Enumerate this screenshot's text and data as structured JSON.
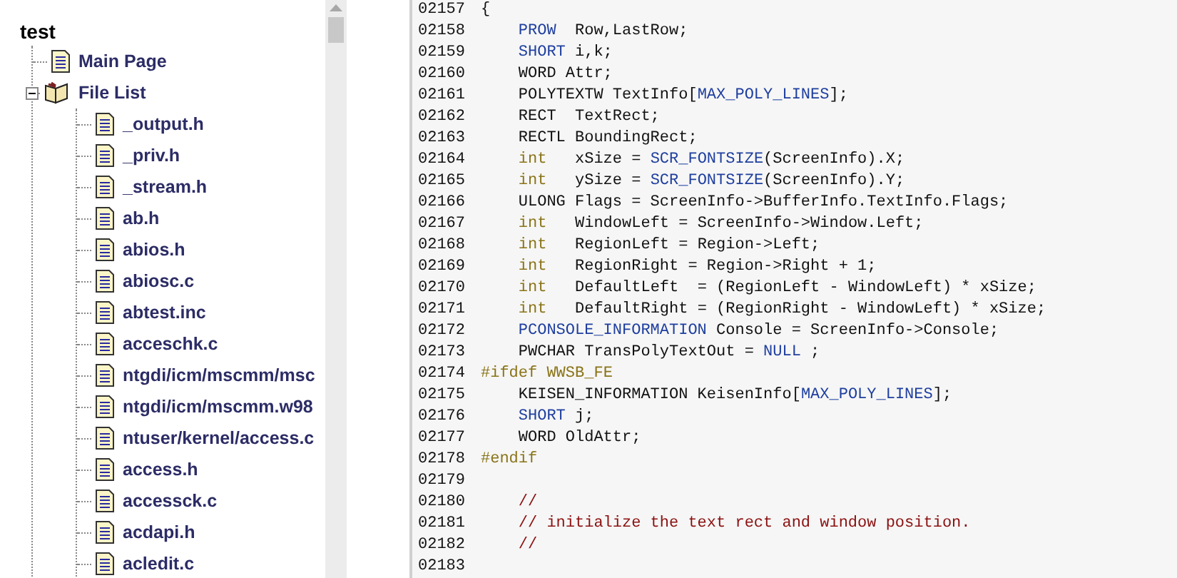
{
  "tree": {
    "root": "test",
    "children": [
      {
        "label": "Main Page",
        "kind": "page"
      },
      {
        "label": "File List",
        "kind": "book",
        "expanded": true,
        "children": [
          {
            "label": "_output.h",
            "kind": "page"
          },
          {
            "label": "_priv.h",
            "kind": "page"
          },
          {
            "label": "_stream.h",
            "kind": "page"
          },
          {
            "label": "ab.h",
            "kind": "page"
          },
          {
            "label": "abios.h",
            "kind": "page"
          },
          {
            "label": "abiosc.c",
            "kind": "page"
          },
          {
            "label": "abtest.inc",
            "kind": "page"
          },
          {
            "label": "acceschk.c",
            "kind": "page"
          },
          {
            "label": "ntgdi/icm/mscmm/msc",
            "kind": "page"
          },
          {
            "label": "ntgdi/icm/mscmm.w98",
            "kind": "page"
          },
          {
            "label": "ntuser/kernel/access.c",
            "kind": "page"
          },
          {
            "label": "access.h",
            "kind": "page"
          },
          {
            "label": "accessck.c",
            "kind": "page"
          },
          {
            "label": "acdapi.h",
            "kind": "page"
          },
          {
            "label": "acledit.c",
            "kind": "page"
          }
        ]
      }
    ]
  },
  "code": {
    "lines": [
      {
        "number": "02157",
        "indent": false,
        "segments": [
          {
            "kind": "plain",
            "text": "{"
          }
        ]
      },
      {
        "number": "02158",
        "indent": true,
        "segments": [
          {
            "kind": "keyword",
            "text": "PROW"
          },
          {
            "kind": "plain",
            "text": "  Row,LastRow;"
          }
        ]
      },
      {
        "number": "02159",
        "indent": true,
        "segments": [
          {
            "kind": "keyword",
            "text": "SHORT"
          },
          {
            "kind": "plain",
            "text": " i,k;"
          }
        ]
      },
      {
        "number": "02160",
        "indent": true,
        "segments": [
          {
            "kind": "plain",
            "text": "WORD Attr;"
          }
        ]
      },
      {
        "number": "02161",
        "indent": true,
        "segments": [
          {
            "kind": "plain",
            "text": "POLYTEXTW TextInfo["
          },
          {
            "kind": "keyword",
            "text": "MAX_POLY_LINES"
          },
          {
            "kind": "plain",
            "text": "];"
          }
        ]
      },
      {
        "number": "02162",
        "indent": true,
        "segments": [
          {
            "kind": "plain",
            "text": "RECT  TextRect;"
          }
        ]
      },
      {
        "number": "02163",
        "indent": true,
        "segments": [
          {
            "kind": "plain",
            "text": "RECTL BoundingRect;"
          }
        ]
      },
      {
        "number": "02164",
        "indent": true,
        "segments": [
          {
            "kind": "type",
            "text": "int"
          },
          {
            "kind": "plain",
            "text": "   xSize = "
          },
          {
            "kind": "keyword",
            "text": "SCR_FONTSIZE"
          },
          {
            "kind": "plain",
            "text": "(ScreenInfo).X;"
          }
        ]
      },
      {
        "number": "02165",
        "indent": true,
        "segments": [
          {
            "kind": "type",
            "text": "int"
          },
          {
            "kind": "plain",
            "text": "   ySize = "
          },
          {
            "kind": "keyword",
            "text": "SCR_FONTSIZE"
          },
          {
            "kind": "plain",
            "text": "(ScreenInfo).Y;"
          }
        ]
      },
      {
        "number": "02166",
        "indent": true,
        "segments": [
          {
            "kind": "plain",
            "text": "ULONG Flags = ScreenInfo->BufferInfo.TextInfo.Flags;"
          }
        ]
      },
      {
        "number": "02167",
        "indent": true,
        "segments": [
          {
            "kind": "type",
            "text": "int"
          },
          {
            "kind": "plain",
            "text": "   WindowLeft = ScreenInfo->Window.Left;"
          }
        ]
      },
      {
        "number": "02168",
        "indent": true,
        "segments": [
          {
            "kind": "type",
            "text": "int"
          },
          {
            "kind": "plain",
            "text": "   RegionLeft = Region->Left;"
          }
        ]
      },
      {
        "number": "02169",
        "indent": true,
        "segments": [
          {
            "kind": "type",
            "text": "int"
          },
          {
            "kind": "plain",
            "text": "   RegionRight = Region->Right + 1;"
          }
        ]
      },
      {
        "number": "02170",
        "indent": true,
        "segments": [
          {
            "kind": "type",
            "text": "int"
          },
          {
            "kind": "plain",
            "text": "   DefaultLeft  = (RegionLeft - WindowLeft) * xSize;"
          }
        ]
      },
      {
        "number": "02171",
        "indent": true,
        "segments": [
          {
            "kind": "type",
            "text": "int"
          },
          {
            "kind": "plain",
            "text": "   DefaultRight = (RegionRight - WindowLeft) * xSize;"
          }
        ]
      },
      {
        "number": "02172",
        "indent": true,
        "segments": [
          {
            "kind": "keyword",
            "text": "PCONSOLE_INFORMATION"
          },
          {
            "kind": "plain",
            "text": " Console = ScreenInfo->Console;"
          }
        ]
      },
      {
        "number": "02173",
        "indent": true,
        "segments": [
          {
            "kind": "plain",
            "text": "PWCHAR TransPolyTextOut = "
          },
          {
            "kind": "keyword",
            "text": "NULL"
          },
          {
            "kind": "plain",
            "text": " ;"
          }
        ]
      },
      {
        "number": "02174",
        "indent": false,
        "segments": [
          {
            "kind": "preproc",
            "text": "#ifdef WWSB_FE"
          }
        ]
      },
      {
        "number": "02175",
        "indent": true,
        "segments": [
          {
            "kind": "plain",
            "text": "KEISEN_INFORMATION KeisenInfo["
          },
          {
            "kind": "keyword",
            "text": "MAX_POLY_LINES"
          },
          {
            "kind": "plain",
            "text": "];"
          }
        ]
      },
      {
        "number": "02176",
        "indent": true,
        "segments": [
          {
            "kind": "keyword",
            "text": "SHORT"
          },
          {
            "kind": "plain",
            "text": " j;"
          }
        ]
      },
      {
        "number": "02177",
        "indent": true,
        "segments": [
          {
            "kind": "plain",
            "text": "WORD OldAttr;"
          }
        ]
      },
      {
        "number": "02178",
        "indent": false,
        "segments": [
          {
            "kind": "preproc",
            "text": "#endif"
          }
        ]
      },
      {
        "number": "02179"
      },
      {
        "number": "02180",
        "indent": true,
        "segments": [
          {
            "kind": "comment",
            "text": "//"
          }
        ]
      },
      {
        "number": "02181",
        "indent": true,
        "segments": [
          {
            "kind": "comment",
            "text": "// initialize the text rect and window position."
          }
        ]
      },
      {
        "number": "02182",
        "indent": true,
        "segments": [
          {
            "kind": "comment",
            "text": "//"
          }
        ]
      },
      {
        "number": "02183"
      }
    ]
  }
}
